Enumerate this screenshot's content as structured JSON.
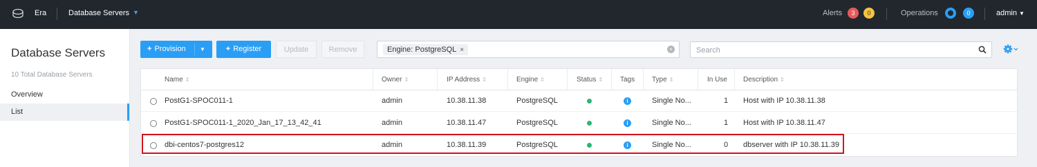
{
  "topbar": {
    "app_name": "Era",
    "section": "Database Servers",
    "alerts_label": "Alerts",
    "alerts_critical": "3",
    "alerts_warning": "0",
    "operations_label": "Operations",
    "operations_count": "0",
    "user": "admin"
  },
  "sidebar": {
    "title": "Database Servers",
    "count": "10 Total Database Servers",
    "nav": [
      "Overview",
      "List"
    ]
  },
  "toolbar": {
    "provision": "Provision",
    "register": "Register",
    "update": "Update",
    "remove": "Remove",
    "filter_chip": "Engine: PostgreSQL",
    "search_placeholder": "Search"
  },
  "table": {
    "columns": [
      "Name",
      "Owner",
      "IP Address",
      "Engine",
      "Status",
      "Tags",
      "Type",
      "In Use",
      "Description"
    ],
    "rows": [
      {
        "name": "PostG1-SPOC011-1",
        "owner": "admin",
        "ip": "10.38.11.38",
        "engine": "PostgreSQL",
        "type": "Single No...",
        "in_use": "1",
        "description": "Host with IP 10.38.11.38"
      },
      {
        "name": "PostG1-SPOC011-1_2020_Jan_17_13_42_41",
        "owner": "admin",
        "ip": "10.38.11.47",
        "engine": "PostgreSQL",
        "type": "Single No...",
        "in_use": "1",
        "description": "Host with IP 10.38.11.47"
      },
      {
        "name": "dbi-centos7-postgres12",
        "owner": "admin",
        "ip": "10.38.11.39",
        "engine": "PostgreSQL",
        "type": "Single No...",
        "in_use": "0",
        "description": "dbserver with IP 10.38.11.39"
      }
    ]
  },
  "colors": {
    "accent": "#2a9ef5",
    "topbar": "#22272e",
    "status_ok": "#2bb673",
    "alert_red": "#e85a5a",
    "alert_yellow": "#f5c43d",
    "highlight": "#d4111e"
  }
}
